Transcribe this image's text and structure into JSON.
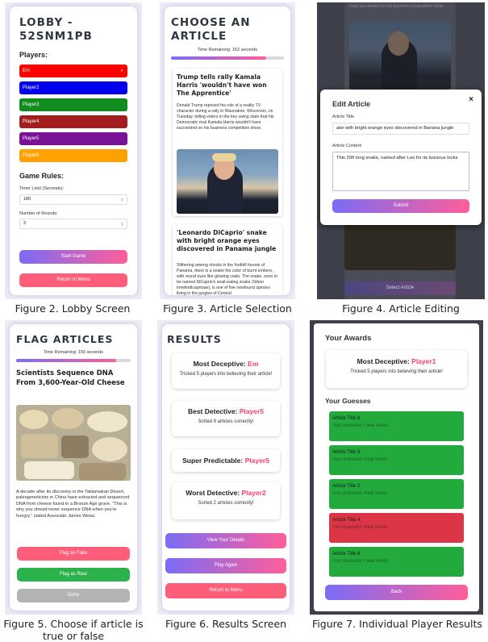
{
  "lobby": {
    "title": "LOBBY - 52SNM1PB",
    "players_heading": "Players:",
    "players": [
      {
        "name": "Em",
        "color": "#ff0000"
      },
      {
        "name": "Player2",
        "color": "#0000ee"
      },
      {
        "name": "Player3",
        "color": "#118c1e"
      },
      {
        "name": "Player4",
        "color": "#a31d1d"
      },
      {
        "name": "Player5",
        "color": "#7a1296"
      },
      {
        "name": "Player6",
        "color": "#ffa200"
      }
    ],
    "rules_heading": "Game Rules:",
    "timer_label": "Timer Limit (Seconds):",
    "timer_value": "180",
    "rounds_label": "Number of Rounds:",
    "rounds_value": "3",
    "start_button": "Start Game",
    "menu_button": "Return to Menu"
  },
  "choose": {
    "title": "CHOOSE AN ARTICLE",
    "timer_text": "Time Remaining: 152 seconds",
    "progress": 0.84,
    "articles": [
      {
        "title": "Trump tells rally Kamala Harris 'wouldn't have won The Apprentice'",
        "body": "Donald Trump reprised his role of a reality TV character during a rally in Waunakee, Wisconsin, on Tuesday, telling voters in the key swing state that his Democratic rival Kamala Harris wouldn't have succeeded on his business competition show."
      },
      {
        "title": "'Leonardo DiCaprio' snake with bright orange eyes discovered in Panama jungle",
        "body": "Slithering among shrubs in the foothill forests of Panama, there is a snake the color of burnt embers, with round eyes like glowing coals. The snake, soon to be named DiCaprio's snail-eating snake (Sibon irmelindicaprioae), is one of five newfound species living in the jungles of Central"
      }
    ]
  },
  "edit": {
    "bg_text": "have succeeded on his business competition show.",
    "heading": "Edit Article",
    "close": "×",
    "title_label": "Article Title",
    "title_value": "ake with bright orange eyes discovered in Banana jungle",
    "content_label": "Article Content",
    "content_value": "This 20ft long snake, named after Leo for its luscious locks",
    "submit": "Submit",
    "select_button": "Select Article"
  },
  "flag": {
    "title": "FLAG ARTICLES",
    "timer_text": "Time Remaining: 156 seconds",
    "progress": 0.87,
    "article_title": "Scientists Sequence DNA From 3,600-Year-Old Cheese",
    "article_body": "A decade after its discovery in the Taklamakan Desert, paleogeneticists in China have extracted and sequenced DNA from cheese found in a Bronze Age grave. \"This is why you should never sequence DNA when you're hungry.\" stated Associate James Weiss.",
    "fake_button": "Flag as Fake",
    "real_button": "Flag as Real",
    "done_button": "Done"
  },
  "results": {
    "title": "RESULTS",
    "awards": [
      {
        "label": "Most Deceptive:",
        "name": "Em",
        "detail": "Tricked 5 players into believing their article!"
      },
      {
        "label": "Best Detective:",
        "name": "Player5",
        "detail": "Sorted 9 articles correctly!"
      },
      {
        "label": "Super Predictable:",
        "name": "Player5",
        "detail": ""
      },
      {
        "label": "Worst Detective:",
        "name": "Player2",
        "detail": "Sorted 2 articles correctly!"
      }
    ],
    "details_button": "View Your Details",
    "again_button": "Play Again",
    "menu_button": "Return to Menu"
  },
  "individual": {
    "awards_heading": "Your Awards",
    "award_label": "Most Deceptive:",
    "award_name": "Player1",
    "award_detail": "Tricked 5 players into believing their article!",
    "guesses_heading": "Your Guesses",
    "guesses": [
      {
        "title": "Article Title 6",
        "guess": "You Guessed: Fake News",
        "color": "#22aa3c"
      },
      {
        "title": "Article Title 9",
        "guess": "You Guessed: Real News",
        "color": "#22aa3c"
      },
      {
        "title": "Article Title 3",
        "guess": "You Guessed: Real News",
        "color": "#22aa3c"
      },
      {
        "title": "Article Title 4",
        "guess": "You Guessed: Real News",
        "color": "#dc3545"
      },
      {
        "title": "Article Title 8",
        "guess": "You Guessed: Fake News",
        "color": "#22aa3c"
      }
    ],
    "back_button": "Back"
  },
  "captions": {
    "fig2": "Figure 2. Lobby Screen",
    "fig3": "Figure 3. Article Selection",
    "fig4": "Figure 4. Article Editing",
    "fig5": "Figure 5. Choose if article is true or false",
    "fig6": "Figure 6. Results Screen",
    "fig7": "Figure 7. Individual Player Results"
  }
}
